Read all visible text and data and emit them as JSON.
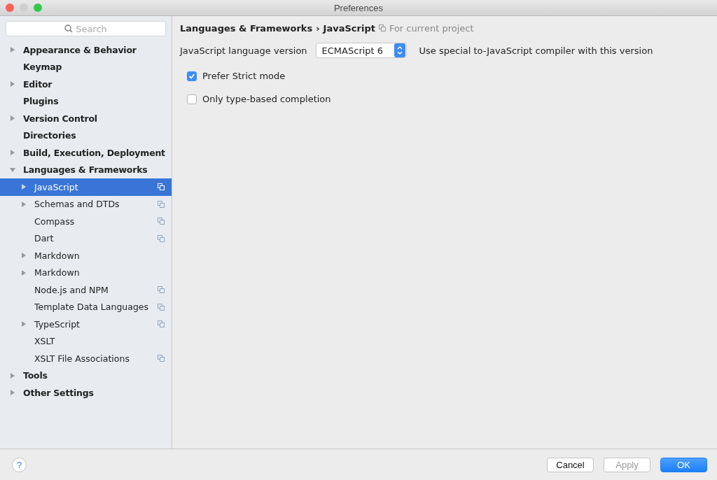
{
  "window": {
    "title": "Preferences"
  },
  "sidebar": {
    "search": {
      "placeholder": "Search"
    },
    "items": [
      {
        "label": "Appearance & Behavior",
        "expanded": false,
        "selected": false,
        "project_scoped": false
      },
      {
        "label": "Keymap",
        "selected": false,
        "project_scoped": false
      },
      {
        "label": "Editor",
        "expanded": false,
        "selected": false,
        "project_scoped": false
      },
      {
        "label": "Plugins",
        "selected": false,
        "project_scoped": false
      },
      {
        "label": "Version Control",
        "expanded": false,
        "selected": false,
        "project_scoped": false
      },
      {
        "label": "Directories",
        "selected": false,
        "project_scoped": false
      },
      {
        "label": "Build, Execution, Deployment",
        "expanded": false,
        "selected": false,
        "project_scoped": false
      },
      {
        "label": "Languages & Frameworks",
        "expanded": true,
        "selected": false,
        "project_scoped": false,
        "children": [
          {
            "label": "JavaScript",
            "expanded": false,
            "selected": true,
            "project_scoped": true
          },
          {
            "label": "Schemas and DTDs",
            "expanded": false,
            "selected": false,
            "project_scoped": true
          },
          {
            "label": "Compass",
            "selected": false,
            "project_scoped": true
          },
          {
            "label": "Dart",
            "selected": false,
            "project_scoped": true
          },
          {
            "label": "Markdown",
            "expanded": false,
            "selected": false,
            "project_scoped": false
          },
          {
            "label": "Markdown",
            "expanded": false,
            "selected": false,
            "project_scoped": false
          },
          {
            "label": "Node.js and NPM",
            "selected": false,
            "project_scoped": true
          },
          {
            "label": "Template Data Languages",
            "selected": false,
            "project_scoped": true
          },
          {
            "label": "TypeScript",
            "expanded": false,
            "selected": false,
            "project_scoped": true
          },
          {
            "label": "XSLT",
            "selected": false,
            "project_scoped": false
          },
          {
            "label": "XSLT File Associations",
            "selected": false,
            "project_scoped": true
          }
        ]
      },
      {
        "label": "Tools",
        "expanded": false,
        "selected": false,
        "project_scoped": false
      },
      {
        "label": "Other Settings",
        "expanded": false,
        "selected": false,
        "project_scoped": false
      }
    ]
  },
  "breadcrumb": {
    "parent": "Languages & Frameworks",
    "separator": "›",
    "current": "JavaScript",
    "scope": "For current project"
  },
  "settings": {
    "version_label": "JavaScript language version",
    "version_value": "ECMAScript 6",
    "version_hint": "Use special to-JavaScript compiler with this version",
    "checkboxes": [
      {
        "label": "Prefer Strict mode",
        "checked": true
      },
      {
        "label": "Only type-based completion",
        "checked": false
      }
    ]
  },
  "footer": {
    "help": "?",
    "buttons": [
      {
        "label": "Cancel",
        "kind": "normal",
        "disabled": false
      },
      {
        "label": "Apply",
        "kind": "normal",
        "disabled": true
      },
      {
        "label": "OK",
        "kind": "default",
        "disabled": false
      }
    ]
  }
}
